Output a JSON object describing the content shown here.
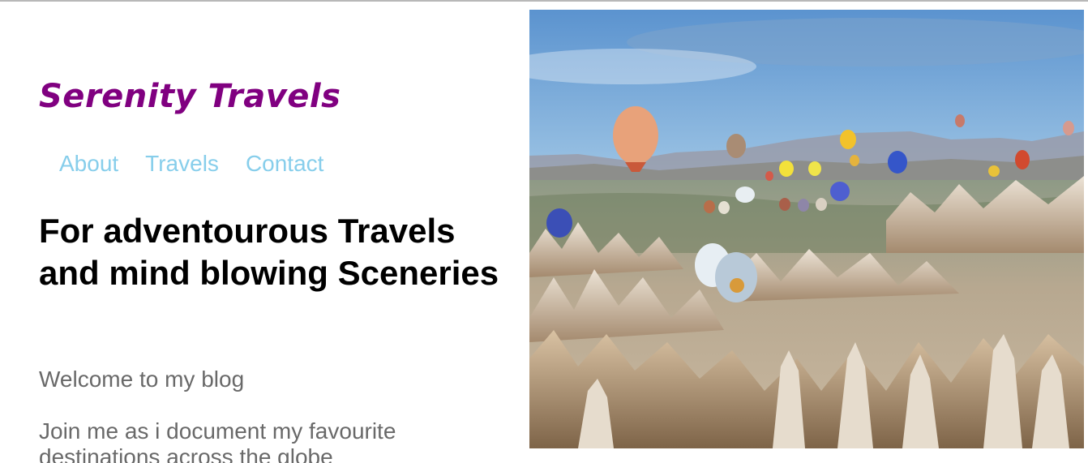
{
  "site": {
    "logo": "Serenity Travels"
  },
  "nav": {
    "items": [
      {
        "label": "About"
      },
      {
        "label": "Travels"
      },
      {
        "label": "Contact"
      }
    ]
  },
  "hero": {
    "headline": "For adventourous Travels and mind blowing Sceneries",
    "intro": "Welcome to my blog",
    "description": "Join me as i document my favourite destinations across the globe"
  },
  "colors": {
    "logo": "#800080",
    "nav_link": "#87CEEB",
    "headline": "#000000",
    "body_text": "#696969"
  }
}
